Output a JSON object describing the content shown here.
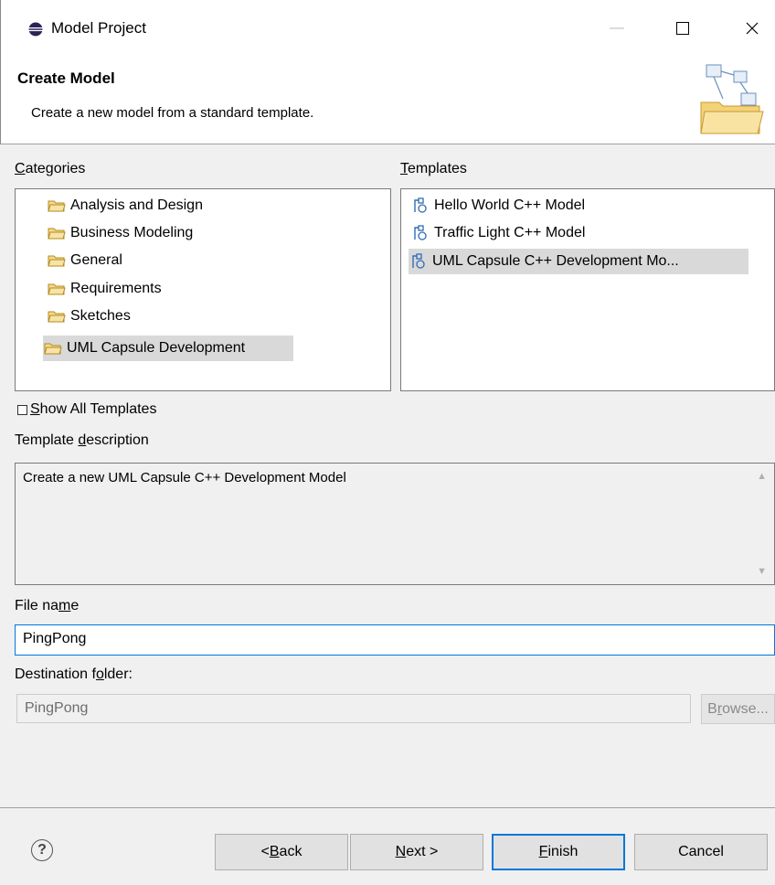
{
  "window": {
    "title": "Model Project",
    "controls": {
      "minimize": "—",
      "maximize": "☐",
      "close": "✕"
    }
  },
  "header": {
    "title": "Create Model",
    "description": "Create a new model from a standard template."
  },
  "categories": {
    "label_pre": "",
    "label_accel": "C",
    "label_post": "ategories",
    "items": [
      {
        "label": "Analysis and Design",
        "selected": false
      },
      {
        "label": "Business Modeling",
        "selected": false
      },
      {
        "label": "General",
        "selected": false
      },
      {
        "label": "Requirements",
        "selected": false
      },
      {
        "label": "Sketches",
        "selected": false
      },
      {
        "label": "UML Capsule Development",
        "selected": true
      }
    ]
  },
  "templates": {
    "label_pre": "",
    "label_accel": "T",
    "label_post": "emplates",
    "items": [
      {
        "label": "Hello World C++ Model",
        "selected": false
      },
      {
        "label": "Traffic Light C++ Model",
        "selected": false
      },
      {
        "label": "UML Capsule C++ Development Mo...",
        "selected": true
      }
    ]
  },
  "show_all": {
    "pre": "",
    "accel": "S",
    "post": "how All Templates",
    "checked": false
  },
  "template_description": {
    "label_pre": "Template ",
    "label_accel": "d",
    "label_post": "escription",
    "text": "Create a new UML Capsule C++ Development Model"
  },
  "file_name": {
    "label_pre": "File na",
    "label_accel": "m",
    "label_post": "e",
    "value": "PingPong"
  },
  "destination": {
    "label_pre": "Destination f",
    "label_accel": "o",
    "label_post": "lder:",
    "value": "PingPong",
    "browse_pre": "B",
    "browse_accel": "r",
    "browse_post": "owse..."
  },
  "buttons": {
    "help": "?",
    "back_pre": "< ",
    "back_accel": "B",
    "back_post": "ack",
    "next_accel": "N",
    "next_post": "ext >",
    "finish_accel": "F",
    "finish_post": "inish",
    "cancel": "Cancel"
  },
  "colors": {
    "accent": "#0078d7",
    "selection": "#d9d9d9",
    "folder": "#e8b84a",
    "template_icon": "#2f6db5"
  },
  "icons": {
    "app": "eclipse-icon",
    "wizard": "wizard-folder-icon",
    "category": "folder-icon",
    "template": "model-template-icon"
  }
}
